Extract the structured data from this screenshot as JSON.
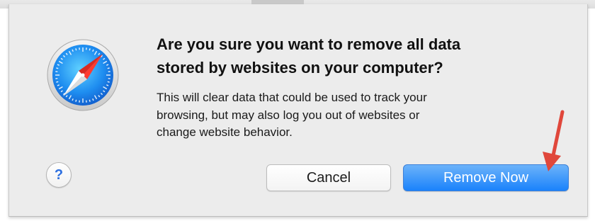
{
  "dialog": {
    "icon": "safari-compass-icon",
    "title_line1": "Are you sure you want to remove all data",
    "title_line2": "stored by websites on your computer?",
    "message_line1": "This will clear data that could be used to track your",
    "message_line2": "browsing, but may also log you out of websites or",
    "message_line3": "change website behavior.",
    "help_label": "?",
    "cancel_label": "Cancel",
    "remove_label": "Remove Now"
  },
  "annotation": {
    "type": "arrow",
    "color": "#e0473b",
    "points_to": "remove-now-button"
  },
  "colors": {
    "primary_button": "#1a82fb",
    "help_glyph": "#2d6fe0",
    "sheet_background": "#ececec"
  }
}
